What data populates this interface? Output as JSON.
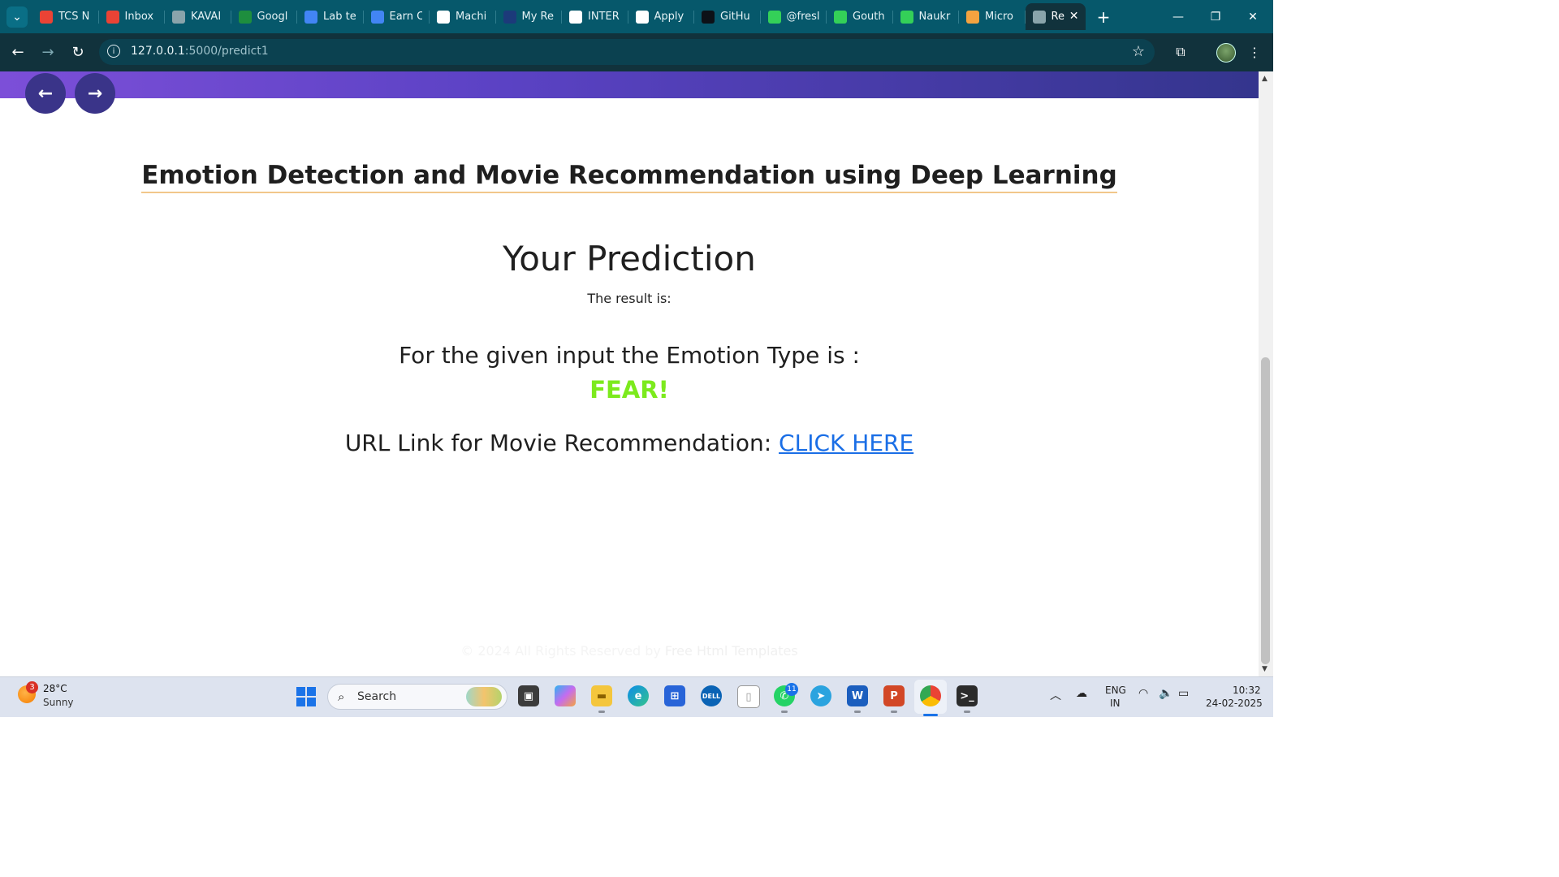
{
  "browser": {
    "tabs": [
      {
        "title": "TCS N",
        "icon": "gmail-icon",
        "color": "#ea4335"
      },
      {
        "title": "Inbox",
        "icon": "gmail-icon",
        "color": "#ea4335"
      },
      {
        "title": "KAVAI",
        "icon": "globe-icon",
        "color": "#8aa4ab"
      },
      {
        "title": "Googl",
        "icon": "classroom-icon",
        "color": "#1e8e3e"
      },
      {
        "title": "Lab te",
        "icon": "cloud-icon",
        "color": "#4285f4"
      },
      {
        "title": "Earn C",
        "icon": "cloud-icon",
        "color": "#4285f4"
      },
      {
        "title": "Machi",
        "icon": "google-icon",
        "color": "#ffffff"
      },
      {
        "title": "My Re",
        "icon": "unstop-icon",
        "color": "#1c3a7a"
      },
      {
        "title": "INTER",
        "icon": "internshala-icon",
        "color": "#ffffff"
      },
      {
        "title": "Apply",
        "icon": "tata-icon",
        "color": "#ffffff"
      },
      {
        "title": "GitHu",
        "icon": "github-icon",
        "color": "#0d1117"
      },
      {
        "title": "@fresl",
        "icon": "asterisk-icon",
        "color": "#34d058"
      },
      {
        "title": "Gouth",
        "icon": "asterisk-icon",
        "color": "#34d058"
      },
      {
        "title": "Naukr",
        "icon": "asterisk-icon",
        "color": "#34d058"
      },
      {
        "title": "Micro",
        "icon": "loading-icon",
        "color": "#f4a340"
      },
      {
        "title": "Re",
        "icon": "globe-icon",
        "color": "#8aa4ab",
        "active": true
      }
    ],
    "url_host": "127.0.0.1",
    "url_path": ":5000/predict1"
  },
  "page": {
    "title": "Emotion Detection and Movie Recommendation using Deep Learning",
    "prediction_heading": "Your Prediction",
    "result_label": "The result is:",
    "emotion_prefix": "For the given input the Emotion Type is :",
    "emotion_value": "FEAR!",
    "emotion_color": "#7cea1d",
    "url_prefix": "URL Link for Movie Recommendation:",
    "url_link_text": "CLICK HERE",
    "footer_prefix": "© 2024 All Rights Reserved by",
    "footer_link": "Free Html Templates"
  },
  "taskbar": {
    "weather_badge": "3",
    "temperature": "28°C",
    "condition": "Sunny",
    "search_placeholder": "Search",
    "whatsapp_badge": "11",
    "lang_top": "ENG",
    "lang_bottom": "IN",
    "time": "10:32",
    "date": "24-02-2025"
  }
}
